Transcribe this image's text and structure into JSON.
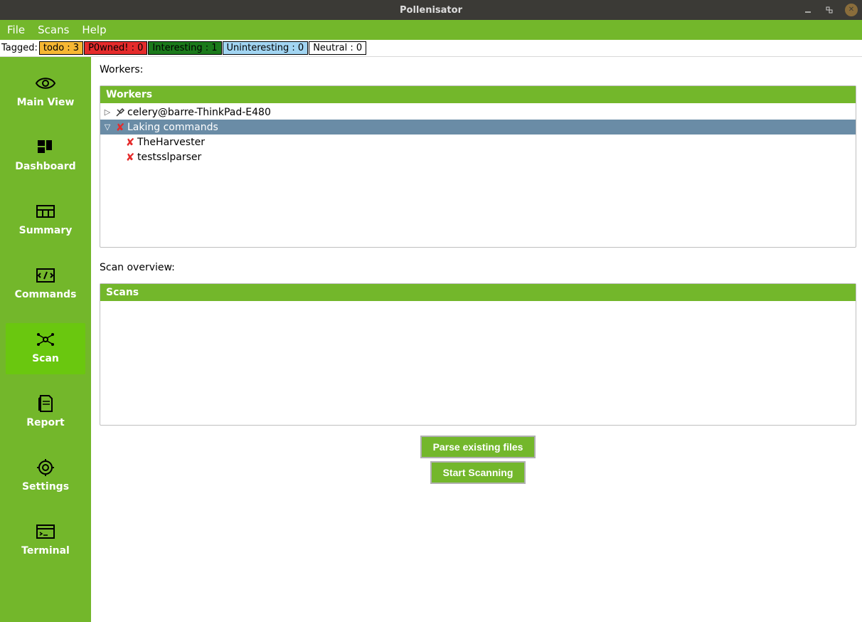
{
  "window": {
    "title": "Pollenisator"
  },
  "menu": {
    "file": "File",
    "scans": "Scans",
    "help": "Help"
  },
  "tags": {
    "label": "Tagged:",
    "todo": "todo : 3",
    "p0wned": "P0wned! : 0",
    "interesting": "Interesting : 1",
    "uninteresting": "Uninteresting : 0",
    "neutral": "Neutral : 0"
  },
  "sidebar": {
    "mainview": "Main View",
    "dashboard": "Dashboard",
    "summary": "Summary",
    "commands": "Commands",
    "scan": "Scan",
    "report": "Report",
    "settings": "Settings",
    "terminal": "Terminal"
  },
  "content": {
    "workers_label": "Workers:",
    "workers_header": "Workers",
    "worker_row1": "celery@barre-ThinkPad-E480",
    "worker_row2": "Laking commands",
    "worker_row3": "TheHarvester",
    "worker_row4": "testsslparser",
    "scanoverview_label": "Scan overview:",
    "scans_header": "Scans",
    "btn_parse": "Parse existing files",
    "btn_start": "Start Scanning"
  }
}
